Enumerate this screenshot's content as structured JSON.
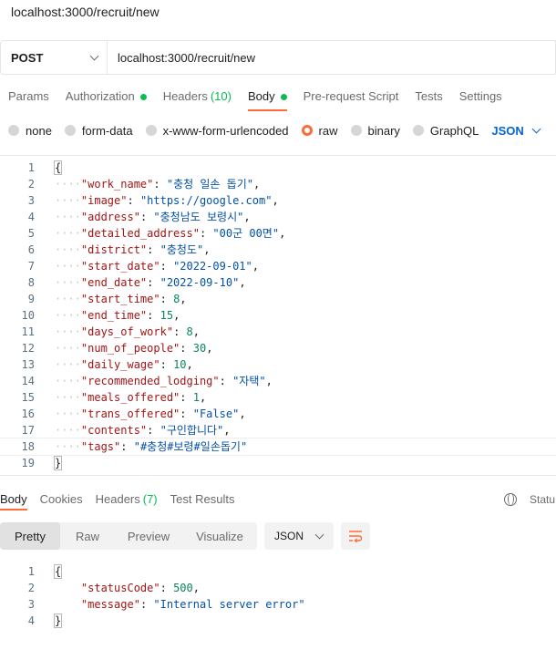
{
  "window": {
    "title": "localhost:3000/recruit/new"
  },
  "request": {
    "method": "POST",
    "url": "localhost:3000/recruit/new"
  },
  "request_tabs": [
    {
      "label": "Params"
    },
    {
      "label": "Authorization",
      "dot": true
    },
    {
      "label": "Headers",
      "count": "(10)"
    },
    {
      "label": "Body",
      "dot": true,
      "active": true
    },
    {
      "label": "Pre-request Script"
    },
    {
      "label": "Tests"
    },
    {
      "label": "Settings"
    }
  ],
  "body_types": {
    "options": [
      "none",
      "form-data",
      "x-www-form-urlencoded",
      "raw",
      "binary",
      "GraphQL"
    ],
    "selected": "raw",
    "language": "JSON"
  },
  "request_body": {
    "line_numbers": [
      "1",
      "2",
      "3",
      "4",
      "5",
      "6",
      "7",
      "8",
      "9",
      "10",
      "11",
      "12",
      "13",
      "14",
      "15",
      "16",
      "17",
      "18",
      "19"
    ],
    "open_brace": "{",
    "close_brace": "}",
    "fields": [
      {
        "key": "\"work_name\"",
        "value": "\"충청 일손 돕기\"",
        "type": "str",
        "comma": ","
      },
      {
        "key": "\"image\"",
        "value": "\"https://google.com\"",
        "type": "str",
        "comma": ","
      },
      {
        "key": "\"address\"",
        "value": "\"충청남도 보령시\"",
        "type": "str",
        "comma": ","
      },
      {
        "key": "\"detailed_address\"",
        "value": "\"00군 00면\"",
        "type": "str",
        "comma": ","
      },
      {
        "key": "\"district\"",
        "value": "\"충청도\"",
        "type": "str",
        "comma": ","
      },
      {
        "key": "\"start_date\"",
        "value": "\"2022-09-01\"",
        "type": "str",
        "comma": ","
      },
      {
        "key": "\"end_date\"",
        "value": "\"2022-09-10\"",
        "type": "str",
        "comma": ","
      },
      {
        "key": "\"start_time\"",
        "value": "8",
        "type": "num",
        "comma": ","
      },
      {
        "key": "\"end_time\"",
        "value": "15",
        "type": "num",
        "comma": ","
      },
      {
        "key": "\"days_of_work\"",
        "value": "8",
        "type": "num",
        "comma": ","
      },
      {
        "key": "\"num_of_people\"",
        "value": "30",
        "type": "num",
        "comma": ","
      },
      {
        "key": "\"daily_wage\"",
        "value": "10",
        "type": "num",
        "comma": ","
      },
      {
        "key": "\"recommended_lodging\"",
        "value": "\"자택\"",
        "type": "str",
        "comma": ","
      },
      {
        "key": "\"meals_offered\"",
        "value": "1",
        "type": "num",
        "comma": ","
      },
      {
        "key": "\"trans_offered\"",
        "value": "\"False\"",
        "type": "str",
        "comma": ","
      },
      {
        "key": "\"contents\"",
        "value": "\"구인합니다\"",
        "type": "str",
        "comma": ","
      },
      {
        "key": "\"tags\"",
        "value": "\"#충청#보령#일손돕기\"",
        "type": "str",
        "comma": ""
      }
    ]
  },
  "response_tabs": [
    {
      "label": "Body",
      "active": true
    },
    {
      "label": "Cookies"
    },
    {
      "label": "Headers",
      "count": "(7)"
    },
    {
      "label": "Test Results"
    }
  ],
  "response_status_label": "Statu",
  "response_view": {
    "modes": [
      "Pretty",
      "Raw",
      "Preview",
      "Visualize"
    ],
    "active": "Pretty",
    "format": "JSON"
  },
  "response_body": {
    "line_numbers": [
      "1",
      "2",
      "3",
      "4"
    ],
    "open_brace": "{",
    "close_brace": "}",
    "fields": [
      {
        "key": "\"statusCode\"",
        "value": "500",
        "type": "num",
        "comma": ","
      },
      {
        "key": "\"message\"",
        "value": "\"Internal server error\"",
        "type": "str",
        "comma": ""
      }
    ]
  },
  "colors": {
    "accent": "#ff6c37",
    "indicator": "#0cbb52",
    "json_link": "#0265d2",
    "key": "#a31515",
    "string": "#0451a5",
    "number": "#098658"
  }
}
